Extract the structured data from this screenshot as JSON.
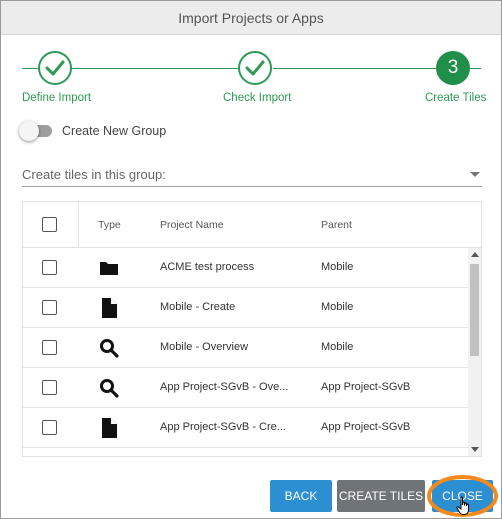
{
  "dialog": {
    "title": "Import Projects or Apps"
  },
  "stepper": {
    "steps": [
      {
        "label": "Define Import",
        "state": "done"
      },
      {
        "label": "Check Import",
        "state": "done"
      },
      {
        "label": "Create Tiles",
        "number": "3",
        "state": "active"
      }
    ]
  },
  "toggle": {
    "label": "Create New Group",
    "on": false
  },
  "group_select": {
    "label": "Create tiles in this group:"
  },
  "table": {
    "headers": {
      "type": "Type",
      "project_name": "Project Name",
      "parent": "Parent"
    },
    "rows": [
      {
        "icon": "folder-icon",
        "name": "ACME test process",
        "parent": "Mobile"
      },
      {
        "icon": "document-icon",
        "name": "Mobile - Create",
        "parent": "Mobile"
      },
      {
        "icon": "search-icon",
        "name": "Mobile - Overview",
        "parent": "Mobile"
      },
      {
        "icon": "search-icon",
        "name": "App Project-SGvB - Ove...",
        "parent": "App Project-SGvB"
      },
      {
        "icon": "document-icon",
        "name": "App Project-SGvB - Cre...",
        "parent": "App Project-SGvB"
      }
    ]
  },
  "buttons": {
    "back": "BACK",
    "create_tiles": "CREATE TILES",
    "close": "CLOSE"
  },
  "colors": {
    "accent_green": "#2e9a55",
    "primary_blue": "#2b8fd1",
    "secondary_gray": "#6f7478",
    "highlight_orange": "#f28a1c"
  }
}
